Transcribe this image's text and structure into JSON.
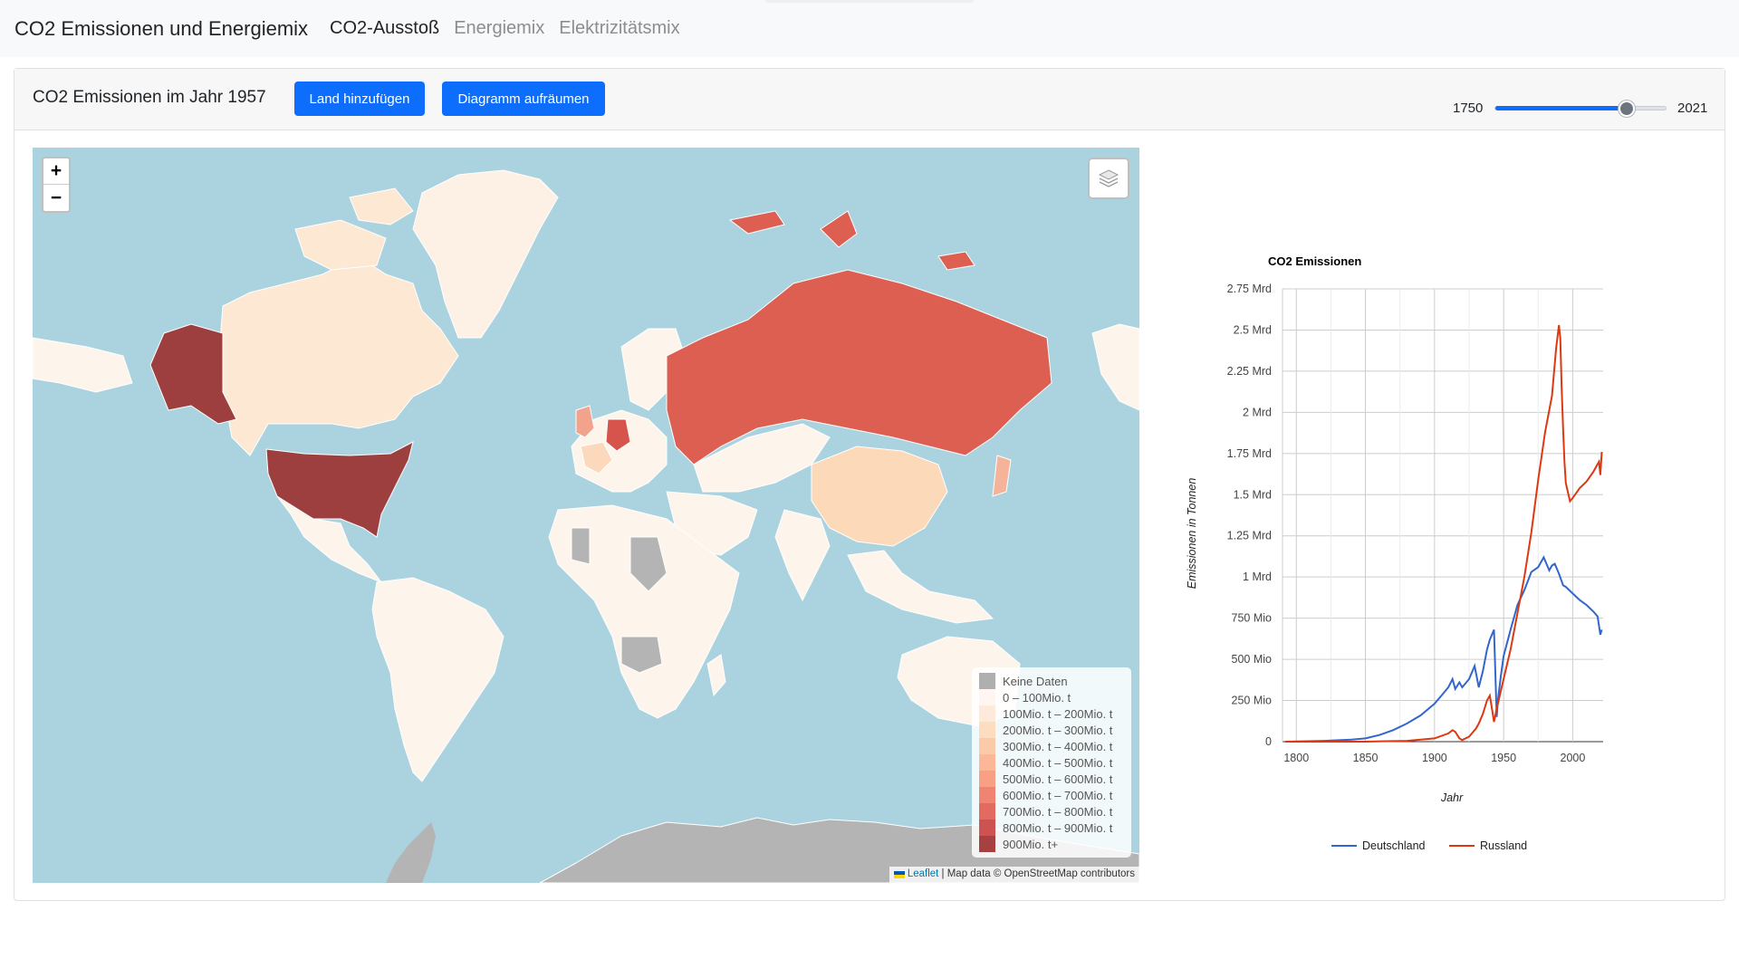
{
  "navbar": {
    "brand": "CO2 Emissionen und Energiemix",
    "links": [
      {
        "label": "CO2-Ausstoß",
        "active": true
      },
      {
        "label": "Energiemix",
        "active": false
      },
      {
        "label": "Elektrizitätsmix",
        "active": false
      }
    ]
  },
  "header": {
    "title": "CO2 Emissionen im Jahr 1957",
    "add_country_label": "Land hinzufügen",
    "clear_chart_label": "Diagramm aufräumen",
    "year_slider": {
      "min_label": "1750",
      "max_label": "2021",
      "min": 1750,
      "max": 2021,
      "value": 1957
    }
  },
  "map": {
    "zoom_in": "+",
    "zoom_out": "−",
    "layers_icon": "layers-icon",
    "legend": [
      {
        "label": "Keine Daten",
        "color": "#a6a6a6"
      },
      {
        "label": "0 – 100Mio. t",
        "color": "#fff5f0"
      },
      {
        "label": "100Mio. t – 200Mio. t",
        "color": "#fee8d6"
      },
      {
        "label": "200Mio. t – 300Mio. t",
        "color": "#fdd9b8"
      },
      {
        "label": "300Mio. t – 400Mio. t",
        "color": "#fcc5a0"
      },
      {
        "label": "400Mio. t – 500Mio. t",
        "color": "#fcaf8d"
      },
      {
        "label": "500Mio. t – 600Mio. t",
        "color": "#f99576"
      },
      {
        "label": "600Mio. t – 700Mio. t",
        "color": "#ef7562"
      },
      {
        "label": "700Mio. t – 800Mio. t",
        "color": "#e05a4f"
      },
      {
        "label": "800Mio. t – 900Mio. t",
        "color": "#c9403f"
      },
      {
        "label": "900Mio. t+",
        "color": "#9e2e2e"
      }
    ],
    "attribution": {
      "leaflet": "Leaflet",
      "rest": " | Map data © OpenStreetMap contributors"
    }
  },
  "chart_data": {
    "type": "line",
    "title": "CO2 Emissionen",
    "xlabel": "Jahr",
    "ylabel": "Emissionen in Tonnen",
    "xlim": [
      1790,
      2022
    ],
    "ylim": [
      0,
      2750000000
    ],
    "x_ticks": [
      1800,
      1850,
      1900,
      1950,
      2000
    ],
    "y_ticks": [
      {
        "value": 0,
        "label": "0"
      },
      {
        "value": 250000000,
        "label": "250 Mio"
      },
      {
        "value": 500000000,
        "label": "500 Mio"
      },
      {
        "value": 750000000,
        "label": "750 Mio"
      },
      {
        "value": 1000000000,
        "label": "1 Mrd"
      },
      {
        "value": 1250000000,
        "label": "1.25 Mrd"
      },
      {
        "value": 1500000000,
        "label": "1.5 Mrd"
      },
      {
        "value": 1750000000,
        "label": "1.75 Mrd"
      },
      {
        "value": 2000000000,
        "label": "2 Mrd"
      },
      {
        "value": 2250000000,
        "label": "2.25 Mrd"
      },
      {
        "value": 2500000000,
        "label": "2.5 Mrd"
      },
      {
        "value": 2750000000,
        "label": "2.75 Mrd"
      }
    ],
    "legend_position": "bottom",
    "series": [
      {
        "name": "Deutschland",
        "color": "#3366cc",
        "x": [
          1792,
          1800,
          1820,
          1840,
          1850,
          1860,
          1870,
          1880,
          1890,
          1900,
          1905,
          1910,
          1913,
          1915,
          1918,
          1920,
          1925,
          1929,
          1932,
          1935,
          1938,
          1940,
          1943,
          1945,
          1946,
          1948,
          1950,
          1955,
          1960,
          1965,
          1970,
          1975,
          1979,
          1980,
          1983,
          1985,
          1987,
          1990,
          1993,
          1995,
          2000,
          2005,
          2010,
          2015,
          2018,
          2020,
          2021
        ],
        "y": [
          0,
          1000000,
          5000000,
          12000000,
          20000000,
          40000000,
          70000000,
          110000000,
          160000000,
          230000000,
          280000000,
          330000000,
          380000000,
          320000000,
          360000000,
          330000000,
          380000000,
          460000000,
          330000000,
          430000000,
          560000000,
          620000000,
          680000000,
          150000000,
          260000000,
          400000000,
          520000000,
          680000000,
          830000000,
          920000000,
          1030000000,
          1060000000,
          1120000000,
          1100000000,
          1040000000,
          1070000000,
          1080000000,
          1020000000,
          950000000,
          940000000,
          900000000,
          860000000,
          830000000,
          790000000,
          760000000,
          650000000,
          680000000
        ]
      },
      {
        "name": "Russland",
        "color": "#dc3912",
        "x": [
          1792,
          1850,
          1880,
          1900,
          1910,
          1913,
          1915,
          1918,
          1920,
          1925,
          1930,
          1932,
          1935,
          1938,
          1940,
          1941,
          1943,
          1945,
          1950,
          1955,
          1960,
          1965,
          1970,
          1975,
          1980,
          1985,
          1988,
          1990,
          1991,
          1992,
          1993,
          1994,
          1995,
          1998,
          2000,
          2005,
          2010,
          2015,
          2019,
          2020,
          2021
        ],
        "y": [
          0,
          0,
          5000000,
          20000000,
          50000000,
          70000000,
          60000000,
          20000000,
          10000000,
          30000000,
          80000000,
          110000000,
          170000000,
          250000000,
          280000000,
          230000000,
          120000000,
          200000000,
          380000000,
          560000000,
          780000000,
          1000000000,
          1270000000,
          1590000000,
          1880000000,
          2100000000,
          2390000000,
          2530000000,
          2450000000,
          2150000000,
          1900000000,
          1700000000,
          1570000000,
          1460000000,
          1480000000,
          1540000000,
          1580000000,
          1640000000,
          1700000000,
          1620000000,
          1760000000
        ]
      }
    ]
  }
}
